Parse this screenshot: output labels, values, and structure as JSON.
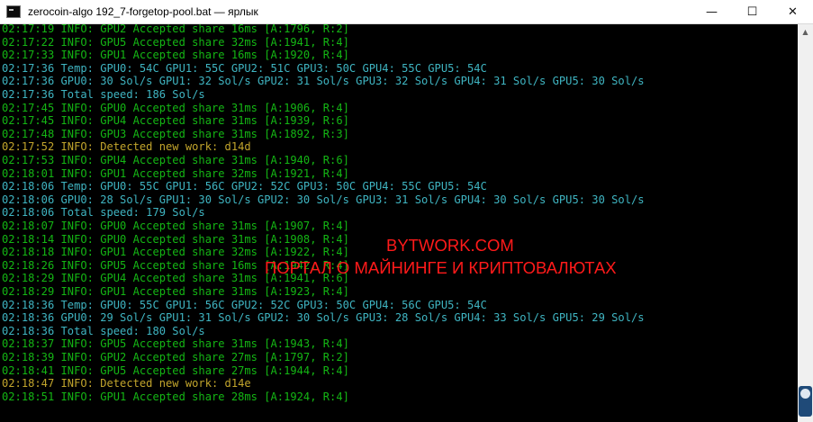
{
  "window": {
    "title": "zerocoin-algo 192_7-forgetop-pool.bat — ярлык",
    "controls": {
      "minimize": "—",
      "maximize": "☐",
      "close": "✕"
    },
    "icon": "console-icon"
  },
  "colors": {
    "green": "#14b614",
    "cyan": "#3fb5c2",
    "yellow": "#c2a52c",
    "background": "#000000",
    "watermark": "#ff1a1a"
  },
  "console_lines": [
    {
      "color": "green",
      "text": "02:17:19 INFO: GPU2 Accepted share 16ms [A:1796, R:2]"
    },
    {
      "color": "green",
      "text": "02:17:22 INFO: GPU5 Accepted share 32ms [A:1941, R:4]"
    },
    {
      "color": "green",
      "text": "02:17:33 INFO: GPU1 Accepted share 16ms [A:1920, R:4]"
    },
    {
      "color": "cyan",
      "text": "02:17:36 Temp: GPU0: 54C GPU1: 55C GPU2: 51C GPU3: 50C GPU4: 55C GPU5: 54C"
    },
    {
      "color": "cyan",
      "text": "02:17:36 GPU0: 30 Sol/s GPU1: 32 Sol/s GPU2: 31 Sol/s GPU3: 32 Sol/s GPU4: 31 Sol/s GPU5: 30 Sol/s"
    },
    {
      "color": "cyan",
      "text": "02:17:36 Total speed: 186 Sol/s"
    },
    {
      "color": "green",
      "text": "02:17:45 INFO: GPU0 Accepted share 31ms [A:1906, R:4]"
    },
    {
      "color": "green",
      "text": "02:17:45 INFO: GPU4 Accepted share 31ms [A:1939, R:6]"
    },
    {
      "color": "green",
      "text": "02:17:48 INFO: GPU3 Accepted share 31ms [A:1892, R:3]"
    },
    {
      "color": "yellow",
      "text": "02:17:52 INFO: Detected new work: d14d"
    },
    {
      "color": "green",
      "text": "02:17:53 INFO: GPU4 Accepted share 31ms [A:1940, R:6]"
    },
    {
      "color": "green",
      "text": "02:18:01 INFO: GPU1 Accepted share 32ms [A:1921, R:4]"
    },
    {
      "color": "cyan",
      "text": "02:18:06 Temp: GPU0: 55C GPU1: 56C GPU2: 52C GPU3: 50C GPU4: 55C GPU5: 54C"
    },
    {
      "color": "cyan",
      "text": "02:18:06 GPU0: 28 Sol/s GPU1: 30 Sol/s GPU2: 30 Sol/s GPU3: 31 Sol/s GPU4: 30 Sol/s GPU5: 30 Sol/s"
    },
    {
      "color": "cyan",
      "text": "02:18:06 Total speed: 179 Sol/s"
    },
    {
      "color": "green",
      "text": "02:18:07 INFO: GPU0 Accepted share 31ms [A:1907, R:4]"
    },
    {
      "color": "green",
      "text": "02:18:14 INFO: GPU0 Accepted share 31ms [A:1908, R:4]"
    },
    {
      "color": "green",
      "text": "02:18:18 INFO: GPU1 Accepted share 32ms [A:1922, R:4]"
    },
    {
      "color": "green",
      "text": "02:18:26 INFO: GPU5 Accepted share 16ms [A:1942, R:4]"
    },
    {
      "color": "green",
      "text": "02:18:29 INFO: GPU4 Accepted share 31ms [A:1941, R:6]"
    },
    {
      "color": "green",
      "text": "02:18:29 INFO: GPU1 Accepted share 31ms [A:1923, R:4]"
    },
    {
      "color": "cyan",
      "text": "02:18:36 Temp: GPU0: 55C GPU1: 56C GPU2: 52C GPU3: 50C GPU4: 56C GPU5: 54C"
    },
    {
      "color": "cyan",
      "text": "02:18:36 GPU0: 29 Sol/s GPU1: 31 Sol/s GPU2: 30 Sol/s GPU3: 28 Sol/s GPU4: 33 Sol/s GPU5: 29 Sol/s"
    },
    {
      "color": "cyan",
      "text": "02:18:36 Total speed: 180 Sol/s"
    },
    {
      "color": "green",
      "text": "02:18:37 INFO: GPU5 Accepted share 31ms [A:1943, R:4]"
    },
    {
      "color": "green",
      "text": "02:18:39 INFO: GPU2 Accepted share 27ms [A:1797, R:2]"
    },
    {
      "color": "green",
      "text": "02:18:41 INFO: GPU5 Accepted share 27ms [A:1944, R:4]"
    },
    {
      "color": "yellow",
      "text": "02:18:47 INFO: Detected new work: d14e"
    },
    {
      "color": "green",
      "text": "02:18:51 INFO: GPU1 Accepted share 28ms [A:1924, R:4]"
    }
  ],
  "watermark": {
    "line1": "BYTWORK.COM",
    "line2": "ПОРТАЛ О МАЙНИНГЕ И КРИПТОВАЛЮТАХ"
  },
  "scrollbar": {
    "up_icon": "▲",
    "down_icon": "▼",
    "widget_icon": "remote-widget-icon"
  }
}
